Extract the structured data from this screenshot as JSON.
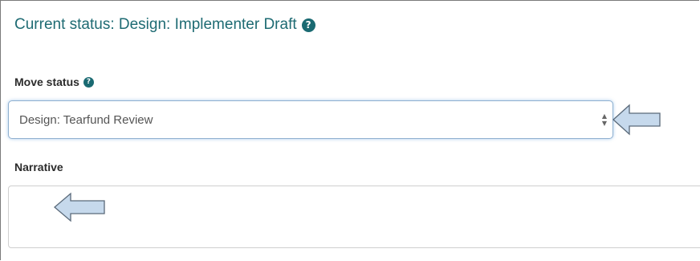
{
  "heading": {
    "text": "Current status: Design: Implementer Draft"
  },
  "move_status": {
    "label": "Move status",
    "selected_value": "Design: Tearfund Review"
  },
  "narrative": {
    "label": "Narrative",
    "value": ""
  },
  "icons": {
    "help": "question-circle-icon",
    "annotation": "left-arrow-icon"
  },
  "colors": {
    "heading": "#1e6b73",
    "help_icon": "#1a6a72",
    "select_focus_border": "#8fb0d0",
    "annotation_arrow_fill": "#c6d9ec",
    "annotation_arrow_stroke": "#5a6a7a"
  }
}
